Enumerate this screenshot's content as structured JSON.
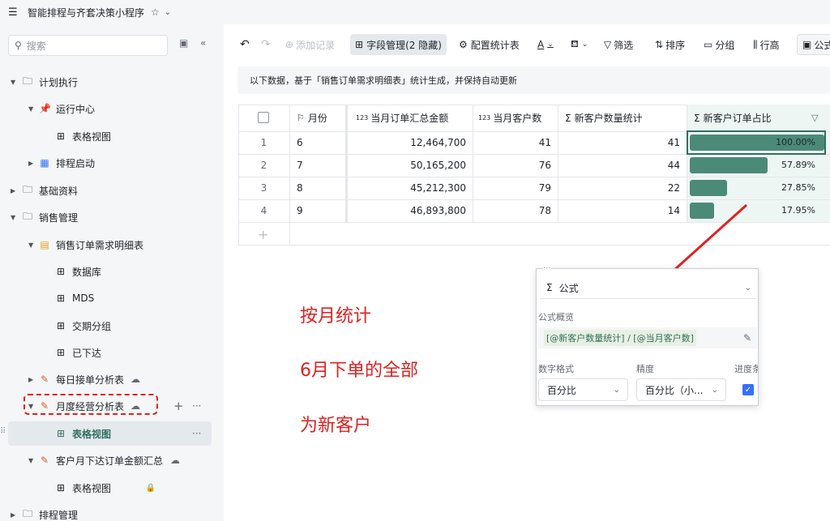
{
  "app": {
    "title": "智能排程与齐套决策小程序",
    "menu_icon": "hamburger-icon",
    "star_icon": "star-icon"
  },
  "sidebar": {
    "search_placeholder": "搜索",
    "items": [
      {
        "label": "计划执行",
        "type": "folder"
      },
      {
        "label": "运行中心",
        "type": "pin"
      },
      {
        "label": "表格视图",
        "type": "grid"
      },
      {
        "label": "排程启动",
        "type": "calendar"
      },
      {
        "label": "基础资料",
        "type": "folder"
      },
      {
        "label": "销售管理",
        "type": "folder"
      },
      {
        "label": "销售订单需求明细表",
        "type": "clipboard"
      },
      {
        "label": "数据库",
        "type": "grid"
      },
      {
        "label": "MDS",
        "type": "grid"
      },
      {
        "label": "交期分组",
        "type": "grid"
      },
      {
        "label": "已下达",
        "type": "grid"
      },
      {
        "label": "每日接单分析表",
        "type": "note"
      },
      {
        "label": "月度经营分析表",
        "type": "note"
      },
      {
        "label": "表格视图",
        "type": "grid"
      },
      {
        "label": "客户月下达订单金额汇总",
        "type": "note"
      },
      {
        "label": "表格视图",
        "type": "grid"
      },
      {
        "label": "排程管理",
        "type": "folder"
      }
    ],
    "row_add": "+",
    "row_more": "···"
  },
  "toolbar": {
    "add_record": "添加记录",
    "field_mgmt": "字段管理(2 隐藏)",
    "config_stats": "配置统计表",
    "text_color": "A",
    "filter": "筛选",
    "sort": "排序",
    "group": "分组",
    "row_height": "行高",
    "formula": "公式"
  },
  "notice": "以下数据，基于「销售订单需求明细表」统计生成，并保持自动更新",
  "table": {
    "headers": [
      "月份",
      "当月订单汇总金额",
      "当月客户数",
      "新客户数量统计",
      "新客户订单占比"
    ],
    "header_icons": [
      "flag-icon",
      "number-icon",
      "number-icon",
      "sigma-icon",
      "sigma-icon"
    ],
    "rows": [
      {
        "idx": "1",
        "month": "6",
        "amount": "12,464,700",
        "customers": "41",
        "new_customers": "41",
        "ratio_label": "100.00%",
        "ratio": 1.0
      },
      {
        "idx": "2",
        "month": "7",
        "amount": "50,165,200",
        "customers": "76",
        "new_customers": "44",
        "ratio_label": "57.89%",
        "ratio": 0.5789
      },
      {
        "idx": "3",
        "month": "8",
        "amount": "45,212,300",
        "customers": "79",
        "new_customers": "22",
        "ratio_label": "27.85%",
        "ratio": 0.2785
      },
      {
        "idx": "4",
        "month": "9",
        "amount": "46,893,800",
        "customers": "78",
        "new_customers": "14",
        "ratio_label": "17.95%",
        "ratio": 0.1795
      }
    ],
    "add_row": "+"
  },
  "popup": {
    "type_label": "公式",
    "overview_title": "公式概览",
    "formula": "[@新客户数量统计] / [@当月客户数]",
    "number_format_label": "数字格式",
    "precision_label": "精度",
    "progress_label": "进度条",
    "number_format_value": "百分比",
    "precision_value": "百分比（小..."
  },
  "annotations": {
    "line1": "按月统计",
    "line2": "6月下单的全部",
    "line3": "为新客户"
  },
  "colors": {
    "bar": "#4c8a78",
    "annotation": "#e02020",
    "checkbox": "#3370ff"
  }
}
